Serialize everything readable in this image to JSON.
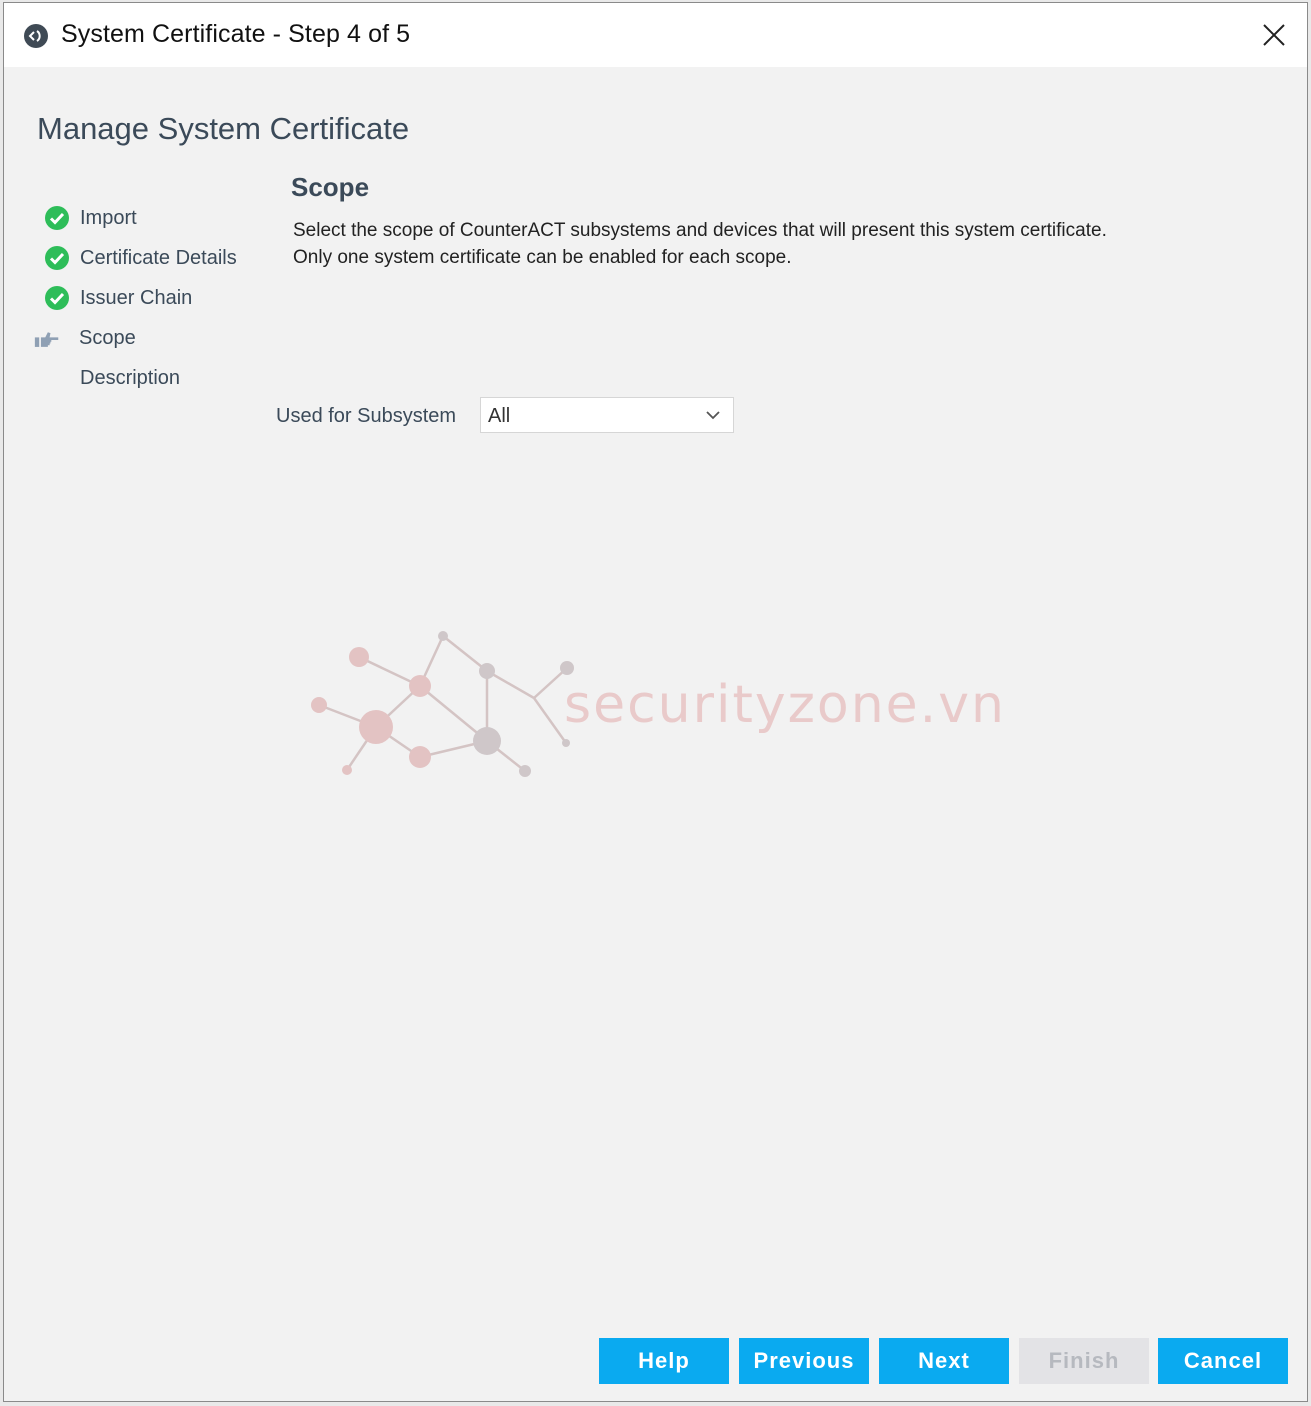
{
  "window": {
    "title": "System Certificate - Step 4 of 5"
  },
  "heading": "Manage System Certificate",
  "steps": [
    {
      "label": "Import",
      "status": "complete",
      "icon": "check-circle-icon"
    },
    {
      "label": "Certificate Details",
      "status": "complete",
      "icon": "check-circle-icon"
    },
    {
      "label": "Issuer Chain",
      "status": "complete",
      "icon": "check-circle-icon"
    },
    {
      "label": "Scope",
      "status": "current",
      "icon": "pointing-hand-icon"
    },
    {
      "label": "Description",
      "status": "pending",
      "icon": ""
    }
  ],
  "section": {
    "title": "Scope",
    "description_line1": "Select the scope of CounterACT subsystems and devices that will present this system certificate.",
    "description_line2": "Only one system certificate can be enabled for each scope."
  },
  "subsystem": {
    "label": "Used for Subsystem",
    "value": "All"
  },
  "watermark": {
    "text": "securityzone.vn"
  },
  "buttons": {
    "help": "Help",
    "previous": "Previous",
    "next": "Next",
    "finish": "Finish",
    "cancel": "Cancel"
  },
  "colors": {
    "accent": "#0aaaf0",
    "check_green": "#2ebd59",
    "heading_text": "#3b4a59",
    "disabled_button": "#e3e3e6"
  }
}
